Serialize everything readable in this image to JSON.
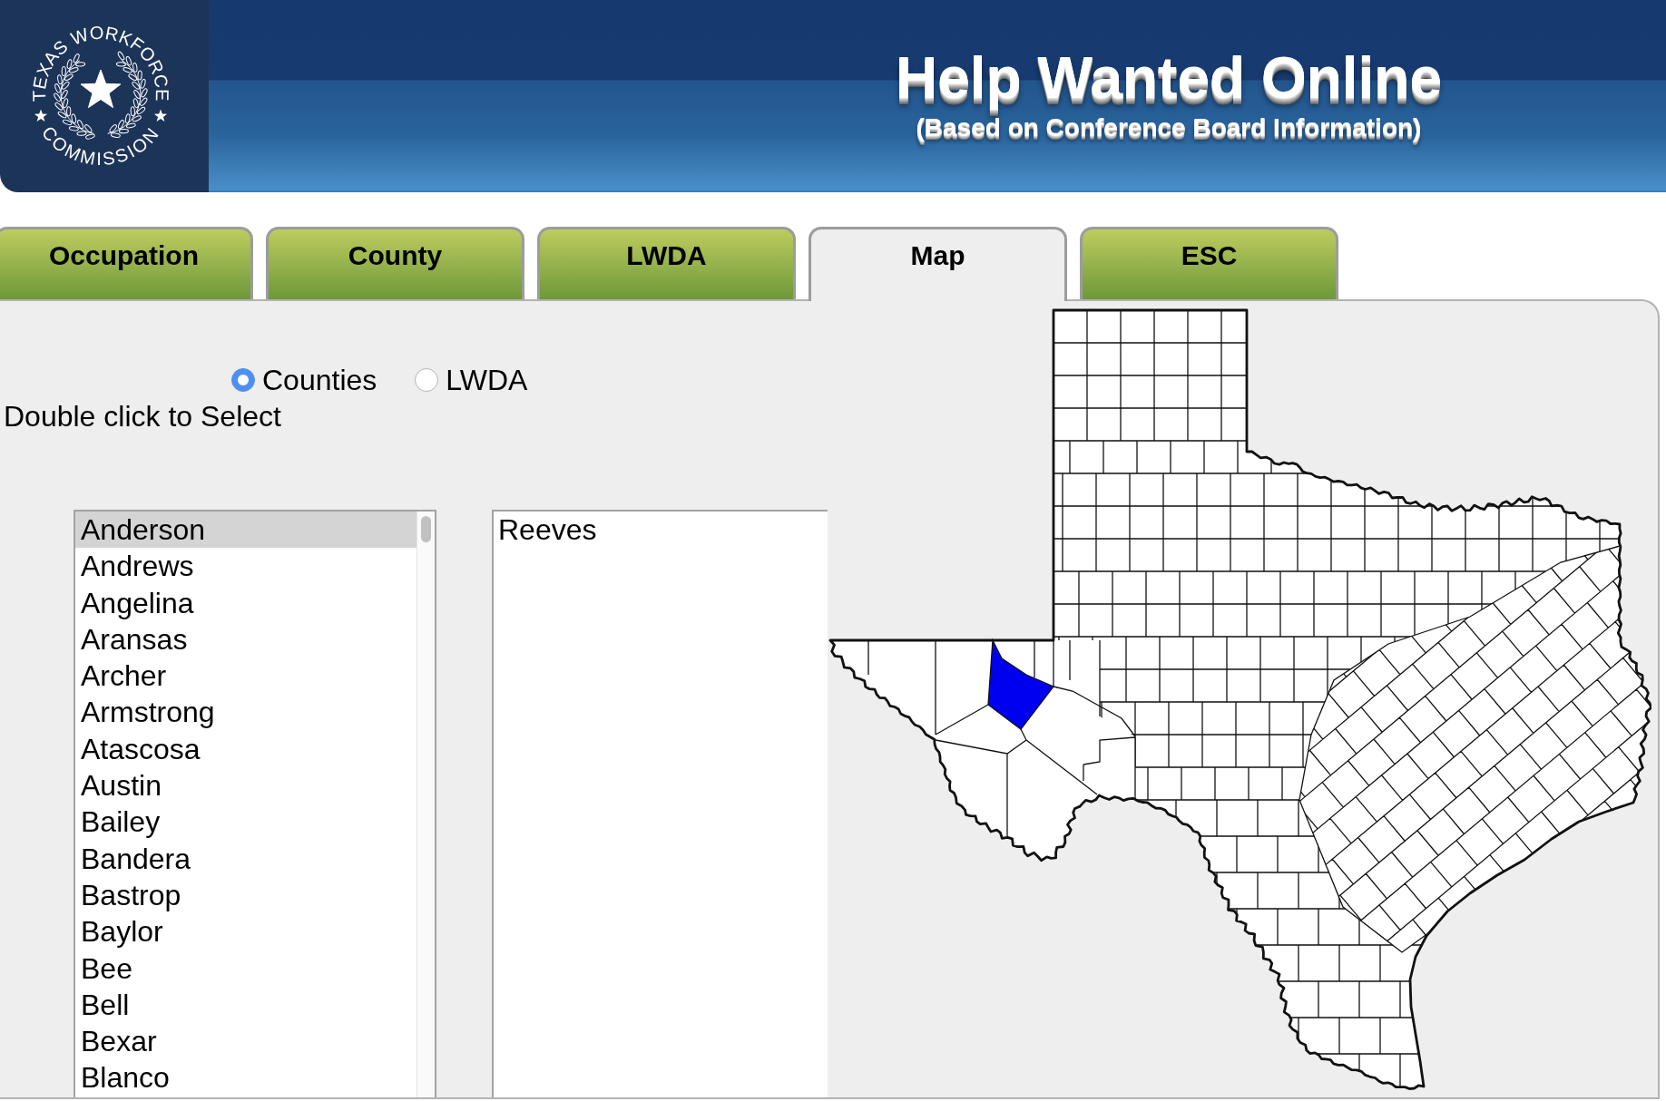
{
  "header": {
    "logo": {
      "top_text": "TEXAS WORKFORCE",
      "bottom_text": "COMMISSION"
    },
    "title": "Help Wanted Online",
    "subtitle": "(Based on Conference Board Information)"
  },
  "tabs": [
    {
      "label": "Occupation",
      "selected": false
    },
    {
      "label": "County",
      "selected": false
    },
    {
      "label": "LWDA",
      "selected": false
    },
    {
      "label": "Map",
      "selected": true
    },
    {
      "label": "ESC",
      "selected": false
    }
  ],
  "map_tab": {
    "area_types": [
      {
        "label": "Counties",
        "selected": true
      },
      {
        "label": "LWDA",
        "selected": false
      }
    ],
    "instruction": "Double click to Select",
    "county_list": [
      {
        "label": "Anderson",
        "selected": true
      },
      {
        "label": "Andrews",
        "selected": false
      },
      {
        "label": "Angelina",
        "selected": false
      },
      {
        "label": "Aransas",
        "selected": false
      },
      {
        "label": "Archer",
        "selected": false
      },
      {
        "label": "Armstrong",
        "selected": false
      },
      {
        "label": "Atascosa",
        "selected": false
      },
      {
        "label": "Austin",
        "selected": false
      },
      {
        "label": "Bailey",
        "selected": false
      },
      {
        "label": "Bandera",
        "selected": false
      },
      {
        "label": "Bastrop",
        "selected": false
      },
      {
        "label": "Baylor",
        "selected": false
      },
      {
        "label": "Bee",
        "selected": false
      },
      {
        "label": "Bell",
        "selected": false
      },
      {
        "label": "Bexar",
        "selected": false
      },
      {
        "label": "Blanco",
        "selected": false
      }
    ],
    "selected_list": [
      {
        "label": "Reeves",
        "selected": false
      }
    ],
    "map": {
      "selection_highlighted": true
    }
  }
}
